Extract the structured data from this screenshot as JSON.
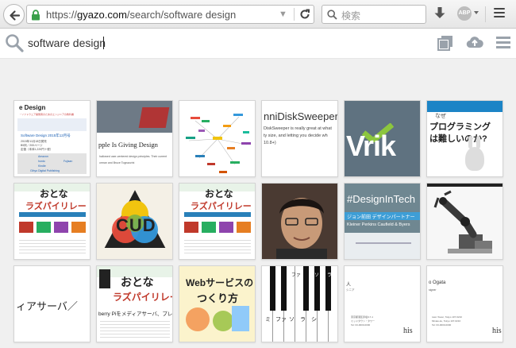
{
  "browser": {
    "url_prefix": "https://",
    "url_domain": "gyazo.com",
    "url_path": "/search/software design",
    "search_placeholder": "検索",
    "abp_label": "ABP"
  },
  "gyazo": {
    "search_query": "software design"
  },
  "tiles": {
    "t1": {
      "title": "e Design",
      "sub": "・ソフトウェア開発者のためのエンジニアの教科書",
      "link": "Software Design 2015年12月号",
      "l1": "2015年11月18日発売",
      "l2": "B5判／200ページ",
      "l3": "定価（本体1,220円＋税）",
      "b1": "Amazon",
      "b2": "honto",
      "b3": "Kindle",
      "b4": "Fujisan",
      "b5": "Gihyo Digital Publishing"
    },
    "t2": {
      "headline": "pple Is Giving Design",
      "sub1": "hallowed user-centered design principles. Their current",
      "sub2": "orman and Bruce Tognazzini"
    },
    "t4": {
      "title": "nniDiskSweeper",
      "l1": "DiskSweeper is really great at what",
      "l2": "ty size, and letting you decide wh",
      "l3": "10.8+)"
    },
    "t5": {
      "word": "Vrik"
    },
    "t6": {
      "header": "なぜ",
      "title1": "プログラミング",
      "title2": "は難しいのか?"
    },
    "t7": {
      "title1": "おとな",
      "title2": "ラズパイリレー"
    },
    "t8": {
      "word": "CUD"
    },
    "t9": {
      "title1": "おとな",
      "title2": "ラズパイリレー"
    },
    "t11": {
      "hashtag": "#DesignInTech",
      "jp": "ジョン前田 デザインパートナー",
      "en": "Kleiner Perkins Caufield & Byers"
    },
    "t13": {
      "text": "ィアサーバ／"
    },
    "t14": {
      "title1": "おとな",
      "title2": "ラズパイリレー",
      "sub": "berry Piをメディアサーバ、プレーヤにしよ"
    },
    "t15": {
      "title1": "Webサービスの",
      "title2": "つくり方"
    },
    "t16": {
      "k1": "ファ",
      "k2": "ソ",
      "k3": "ラ",
      "k4": "ミ",
      "k5": "ファ",
      "k6": "ソ",
      "k7": "ラ",
      "k8": "シ"
    },
    "t17": {
      "name": "人",
      "role": "シニア",
      "addr1": "東京都港区赤坂9-7-1",
      "addr2": "ミッドタウン・タワー",
      "addr3": "Tel: 03-0000-0000",
      "brand": "his"
    },
    "t18": {
      "name": "o Ogata",
      "role": "signer",
      "addr1": "town Tower, Tokyo 107-6210",
      "addr2": "Minato-ku, Tokyo 107-6210",
      "addr3": "Tel: 03-0000-0000",
      "brand": "his"
    }
  },
  "colors": {
    "accent_green": "#3aa04a",
    "gyazo_icon": "#9aa2ab",
    "wrike_bg": "#5f7280",
    "wrike_green": "#8cc63e",
    "design_in_tech_bg": "#6f8791"
  }
}
